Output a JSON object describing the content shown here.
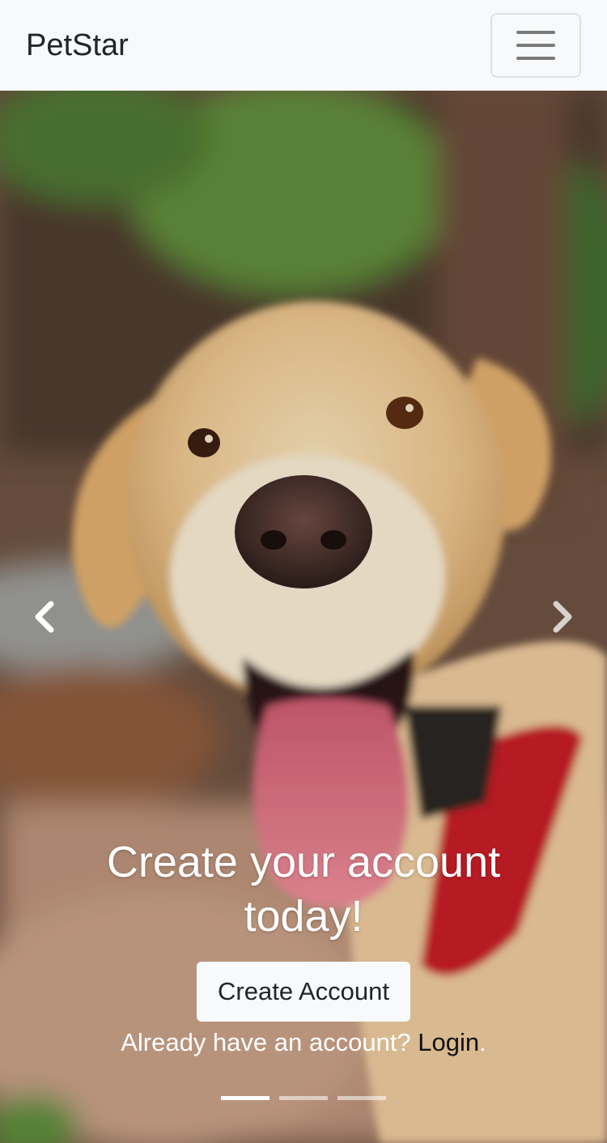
{
  "navbar": {
    "brand": "PetStar",
    "menu_icon": "hamburger-menu-icon"
  },
  "carousel": {
    "slide_image": "dog-photo",
    "prev_icon": "chevron-left-icon",
    "next_icon": "chevron-right-icon",
    "caption": {
      "heading": "Create your account today!",
      "button_label": "Create Account",
      "prompt": "Already have an account?",
      "login_link": "Login",
      "login_suffix": "."
    },
    "active_slide": 1,
    "slide_count": 3
  },
  "colors": {
    "navbar_bg": "#f8f9fa",
    "text_dark": "#212529",
    "caption_text": "#ffffff"
  }
}
